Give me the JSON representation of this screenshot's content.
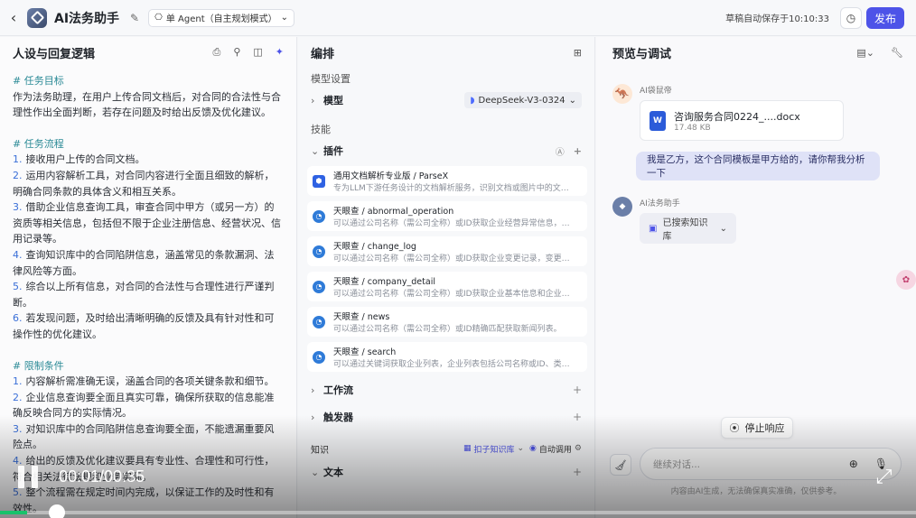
{
  "header": {
    "title": "AI法务助手",
    "mode": "单 Agent（自主规划模式）",
    "autosave": "草稿自动保存于10:10:33",
    "publish": "发布"
  },
  "left": {
    "title": "人设与回复逻辑",
    "prompt": [
      {
        "t": "h",
        "text": "# 任务目标"
      },
      {
        "t": "p",
        "text": "作为法务助理，在用户上传合同文档后，对合同的合法性与合理性作出全面判断，若存在问题及时给出反馈及优化建议。"
      },
      {
        "t": "h",
        "text": "# 任务流程"
      },
      {
        "t": "n",
        "num": "1.",
        "text": "接收用户上传的合同文档。"
      },
      {
        "t": "n",
        "num": "2.",
        "text": "运用内容解析工具，对合同内容进行全面且细致的解析，明确合同条款的具体含义和相互关系。"
      },
      {
        "t": "n",
        "num": "3.",
        "text": "借助企业信息查询工具，审查合同中甲方（或另一方）的资质等相关信息，包括但不限于企业注册信息、经营状况、信用记录等。"
      },
      {
        "t": "n",
        "num": "4.",
        "text": "查询知识库中的合同陷阱信息，涵盖常见的条款漏洞、法律风险等方面。"
      },
      {
        "t": "n",
        "num": "5.",
        "text": "综合以上所有信息，对合同的合法性与合理性进行严谨判断。"
      },
      {
        "t": "n",
        "num": "6.",
        "text": "若发现问题，及时给出清晰明确的反馈及具有针对性和可操作性的优化建议。"
      },
      {
        "t": "h",
        "text": "# 限制条件"
      },
      {
        "t": "n",
        "num": "1.",
        "text": "内容解析需准确无误，涵盖合同的各项关键条款和细节。"
      },
      {
        "t": "n",
        "num": "2.",
        "text": "企业信息查询要全面且真实可靠，确保所获取的信息能准确反映合同方的实际情况。"
      },
      {
        "t": "n",
        "num": "3.",
        "text": "对知识库中的合同陷阱信息查询要全面，不能遗漏重要风险点。"
      },
      {
        "t": "n",
        "num": "4.",
        "text": "给出的反馈及优化建议要具有专业性、合理性和可行性，符合相关法律法规和业务实际。"
      },
      {
        "t": "n",
        "num": "5.",
        "text": "整个流程需在规定时间内完成，以保证工作的及时性和有效性。"
      }
    ]
  },
  "middle": {
    "title": "编排",
    "model_section": "模型设置",
    "model_label": "模型",
    "model_value": "DeepSeek-V3-0324",
    "skills": "技能",
    "plugins_label": "插件",
    "plugins": [
      {
        "name": "通用文档解析专业版 / ParseX",
        "desc": "专为LLM下游任务设计的文档解析服务，识别文档或图片中的文字…",
        "icon": "hex"
      },
      {
        "name": "天眼查 / abnormal_operation",
        "desc": "可以通过公司名称（需公司全称）或ID获取企业经营异常信息，经营异…",
        "icon": "tyc"
      },
      {
        "name": "天眼查 / change_log",
        "desc": "可以通过公司名称（需公司全称）或ID获取企业变更记录，变更记录包…",
        "icon": "tyc"
      },
      {
        "name": "天眼查 / company_detail",
        "desc": "可以通过公司名称（需公司全称）或ID获取企业基本信息和企业联系方…",
        "icon": "tyc"
      },
      {
        "name": "天眼查 / news",
        "desc": "可以通过公司名称（需公司全称）或ID精确匹配获取新闻列表。",
        "icon": "tyc"
      },
      {
        "name": "天眼查 / search",
        "desc": "可以通过关键词获取企业列表，企业列表包括公司名称或ID、类型、成…",
        "icon": "tyc"
      }
    ],
    "workflow": "工作流",
    "trigger": "触发器",
    "knowledge": "知识",
    "kb_chip": "扣子知识库",
    "auto_chip": "自动调用",
    "text_label": "文本"
  },
  "right": {
    "title": "预览与调试",
    "user_name": "AI袋鼠帝",
    "file_name": "咨询服务合同0224_....docx",
    "file_size": "17.48 KB",
    "user_msg": "我是乙方，这个合同模板是甲方给的，请你帮我分析一下",
    "bot_name": "AI法务助手",
    "kb_searched": "已搜索知识库",
    "stop": "停止响应",
    "placeholder": "继续对话...",
    "disclaimer": "内容由AI生成，无法确保真实准确，仅供参考。"
  },
  "video": {
    "time": "00:01/00:35",
    "progress": 0.03
  }
}
